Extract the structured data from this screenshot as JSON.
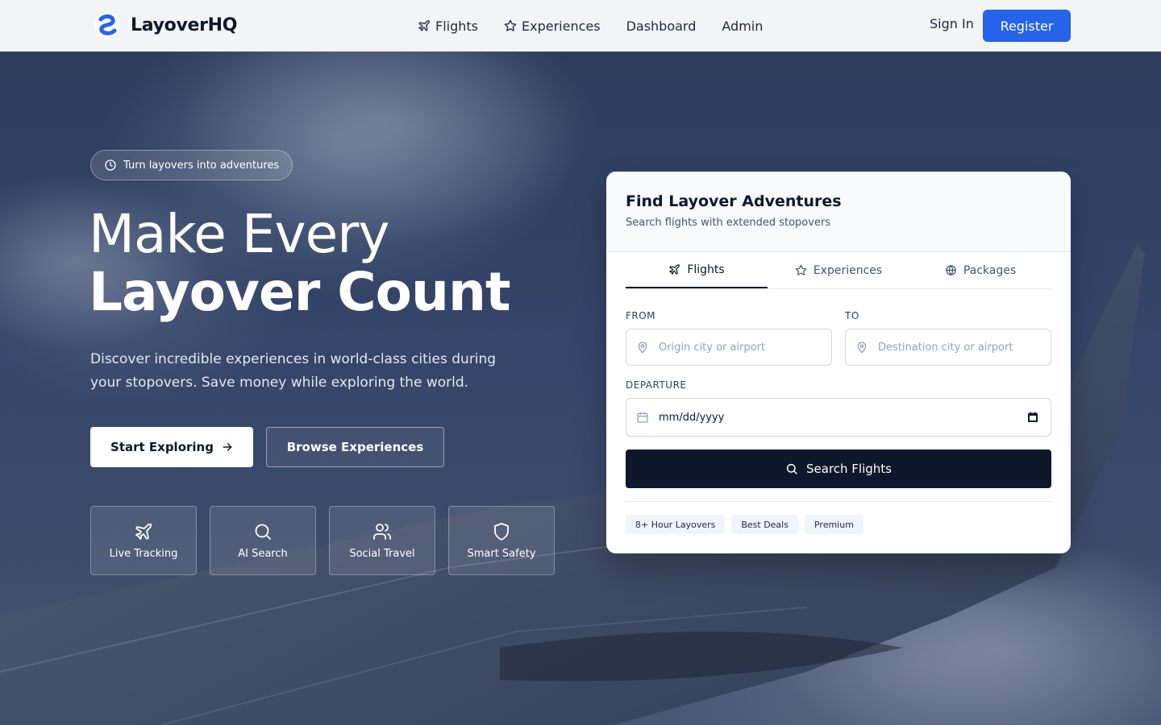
{
  "brand": {
    "name": "LayoverHQ",
    "logo_icon": "layoverhq-logo-icon",
    "color": "#2563eb"
  },
  "nav": {
    "links": [
      {
        "label": "Flights",
        "icon": "plane-icon"
      },
      {
        "label": "Experiences",
        "icon": "star-icon"
      },
      {
        "label": "Dashboard"
      },
      {
        "label": "Admin"
      }
    ],
    "signin": "Sign In",
    "register": "Register"
  },
  "hero": {
    "pill": "Turn layovers into adventures",
    "title_line1": "Make Every",
    "title_line2": "Layover Count",
    "description": "Discover incredible experiences in world-class cities during your stopovers. Save money while exploring the world.",
    "primary_cta": "Start Exploring",
    "secondary_cta": "Browse Experiences",
    "features": [
      {
        "label": "Live Tracking",
        "icon": "plane-icon"
      },
      {
        "label": "AI Search",
        "icon": "search-icon"
      },
      {
        "label": "Social Travel",
        "icon": "users-icon"
      },
      {
        "label": "Smart Safety",
        "icon": "shield-icon"
      }
    ]
  },
  "search_card": {
    "title": "Find Layover Adventures",
    "subtitle": "Search flights with extended stopovers",
    "tabs": [
      {
        "label": "Flights",
        "icon": "plane-icon",
        "active": true
      },
      {
        "label": "Experiences",
        "icon": "star-icon",
        "active": false
      },
      {
        "label": "Packages",
        "icon": "globe-icon",
        "active": false
      }
    ],
    "from_label": "FROM",
    "from_placeholder": "Origin city or airport",
    "to_label": "TO",
    "to_placeholder": "Destination city or airport",
    "departure_label": "DEPARTURE",
    "departure_value": "mm/dd/yyyy",
    "search_button": "Search Flights",
    "tags": [
      "8+ Hour Layovers",
      "Best Deals",
      "Premium"
    ]
  },
  "colors": {
    "accent": "#2563eb",
    "dark": "#0f172a"
  }
}
